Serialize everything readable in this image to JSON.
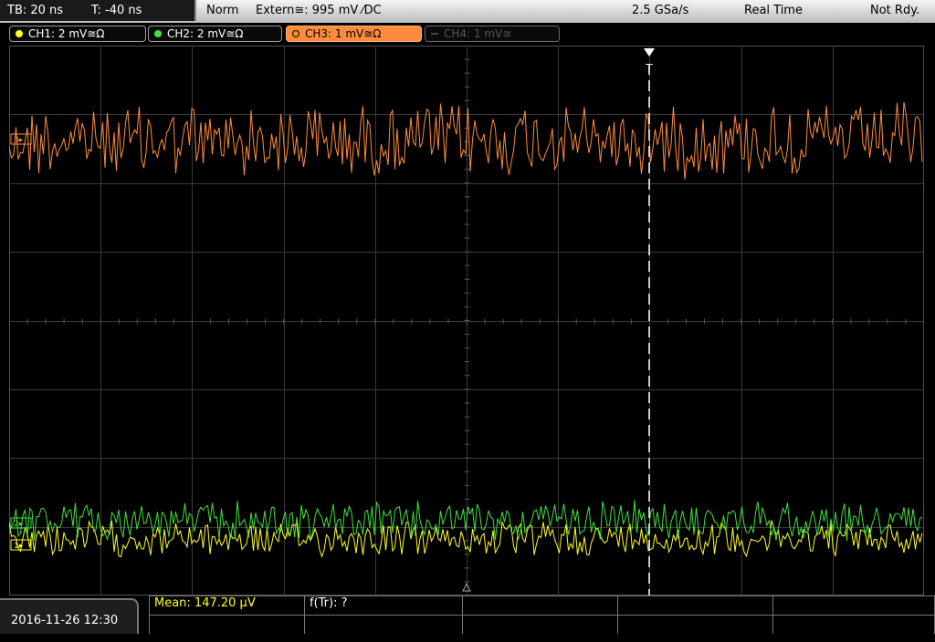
{
  "status": {
    "timebase": "TB: 20 ns",
    "trigger_time": "T: -40 ns",
    "mode": "Norm",
    "trigger_source": "Extern≅: 995 mV ⁄DC",
    "sample_rate": "2.5 GSa/s",
    "acq_mode": "Real Time",
    "state": "Not Rdy."
  },
  "channels": [
    {
      "label": "CH1: 2 mV≅Ω",
      "color": "#ffff20",
      "active": false
    },
    {
      "label": "CH2: 2 mV≅Ω",
      "color": "#40e040",
      "active": false
    },
    {
      "label": "CH3: 1 mV≅Ω",
      "color": "#ff8c3c",
      "active": true
    },
    {
      "label": "CH4: 1 mV≅",
      "color": "#555555",
      "active": false
    }
  ],
  "markers": {
    "trigger_letter": "T",
    "ch3_marker": "3▸",
    "ch2_marker": "2▸",
    "ch1_marker": "1▸"
  },
  "footer": {
    "datetime": "2016-11-26 12:30",
    "mean": "Mean: 147.20 µV",
    "ftr": "f(Tr): ?"
  },
  "colors": {
    "grid": "#3a3a3a",
    "ch1": "#ffff20",
    "ch2": "#40e040",
    "ch3": "#ff8c3c"
  }
}
